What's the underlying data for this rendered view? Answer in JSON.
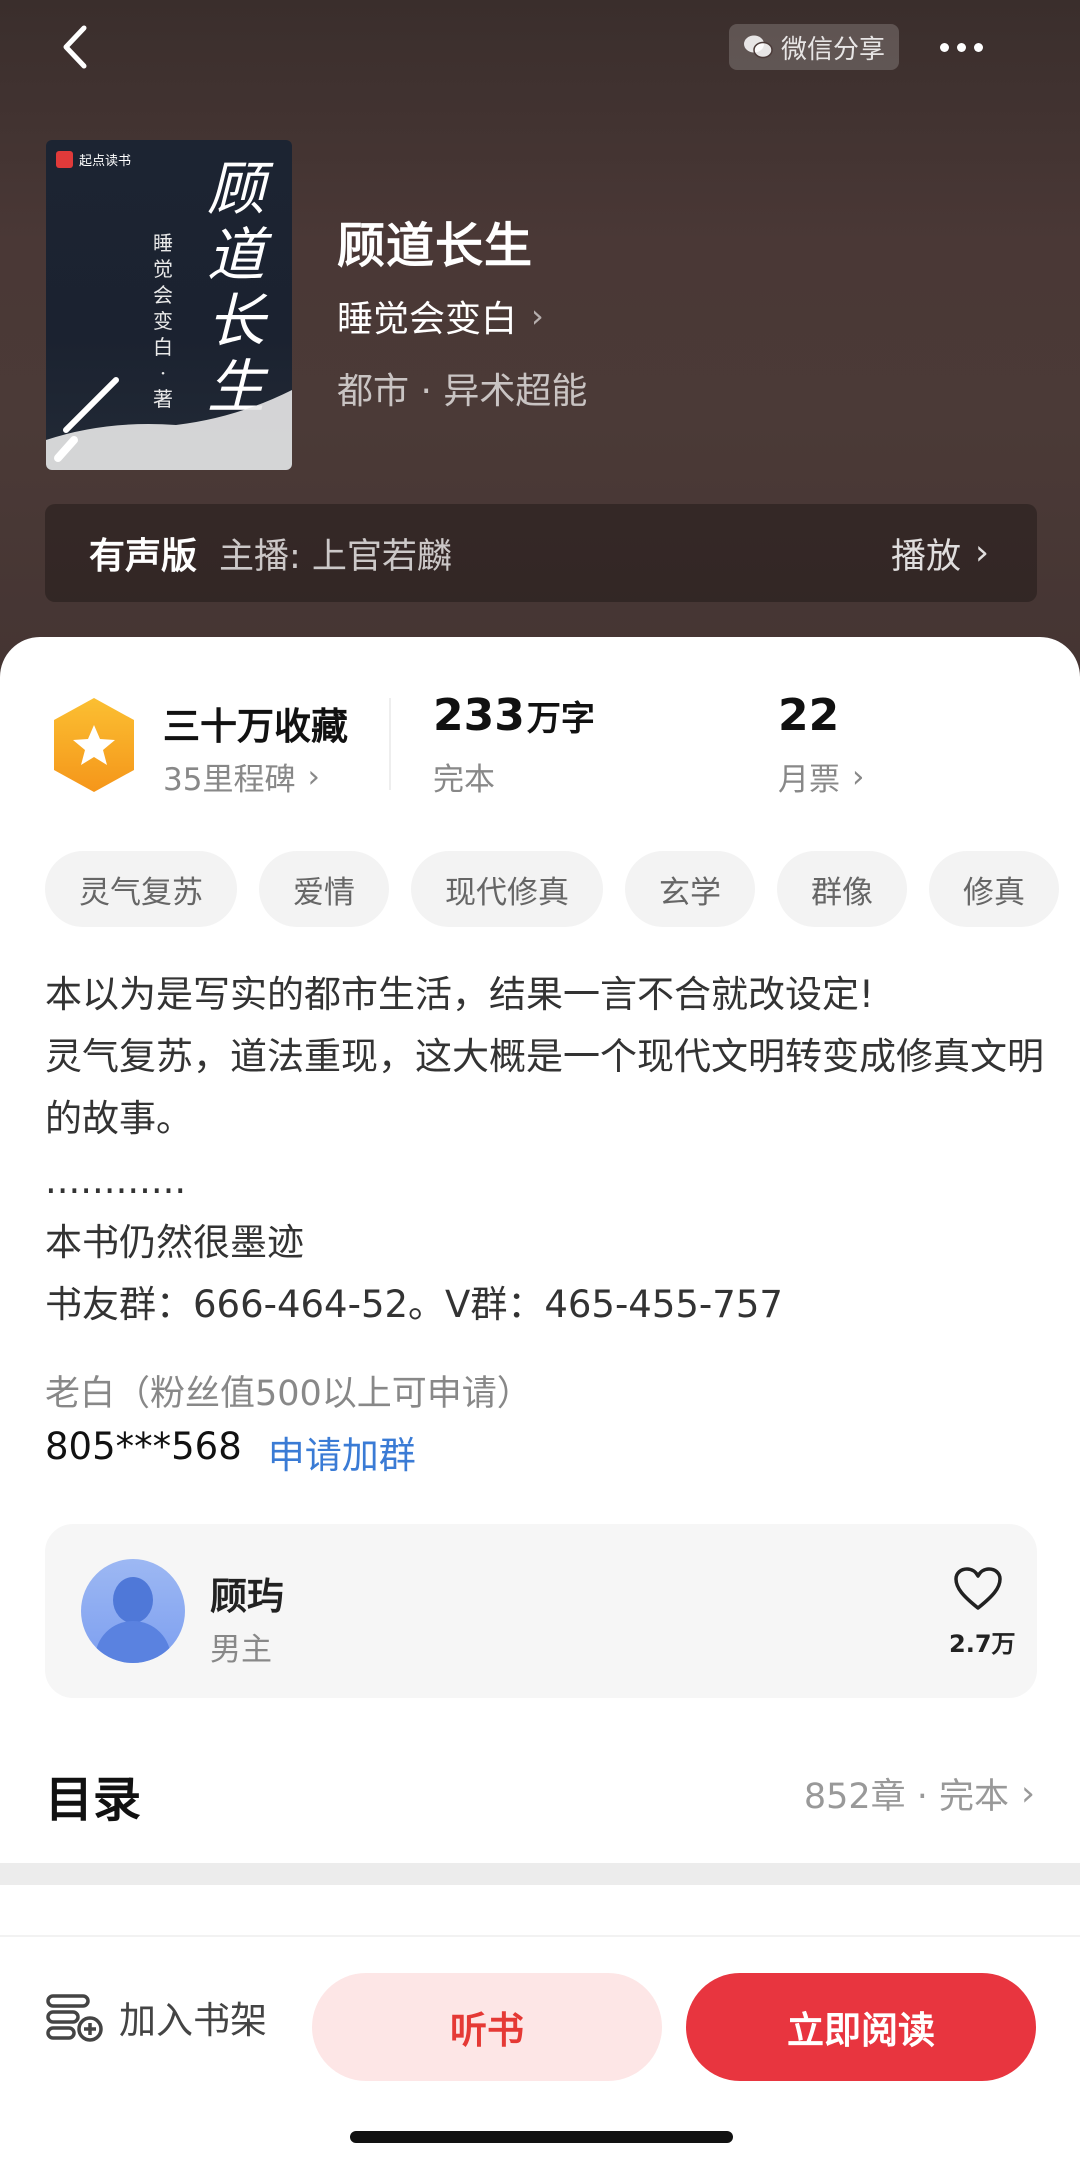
{
  "header": {
    "share_label": "微信分享",
    "icons": {
      "back": "chevron-left-icon",
      "share": "wechat-icon",
      "more": "more-dots-icon"
    }
  },
  "cover": {
    "publisher": "起点读书",
    "title_chars": [
      "顾",
      "道",
      "长",
      "生"
    ],
    "author_chars": [
      "睡",
      "觉",
      "会",
      "变",
      "白",
      "·",
      "著"
    ]
  },
  "book": {
    "title": "顾道长生",
    "author": "睡觉会变白",
    "genre": "都市 · 异术超能"
  },
  "audio": {
    "label": "有声版",
    "anchor": "主播: 上官若麟",
    "play": "播放"
  },
  "stats": {
    "favorites": "三十万收藏",
    "milestone": "35里程碑",
    "words_num": "233",
    "words_unit": "万字",
    "status": "完本",
    "tickets_num": "22",
    "tickets_label": "月票"
  },
  "tags": [
    "灵气复苏",
    "爱情",
    "现代修真",
    "玄学",
    "群像",
    "修真"
  ],
  "description": {
    "lines": [
      "本以为是写实的都市生活，结果一言不合就改设定!",
      "灵气复苏，道法重现，这大概是一个现代文明转变成修真文明的故事。",
      "............",
      "本书仍然很墨迹",
      "书友群：666-464-52。V群：465-455-757"
    ],
    "fans_note": "老白（粉丝值500以上可申请）",
    "qq": "805***568",
    "apply": "申请加群"
  },
  "character": {
    "name": "顾玙",
    "role": "男主",
    "likes": "2.7万"
  },
  "toc": {
    "title": "目录",
    "info": "852章 · 完本"
  },
  "bottom_bar": {
    "add_shelf": "加入书架",
    "listen": "听书",
    "read": "立即阅读"
  },
  "colors": {
    "accent_red": "#e8353f",
    "link_blue": "#3a7bd5",
    "badge_orange": "#f7a21b"
  }
}
